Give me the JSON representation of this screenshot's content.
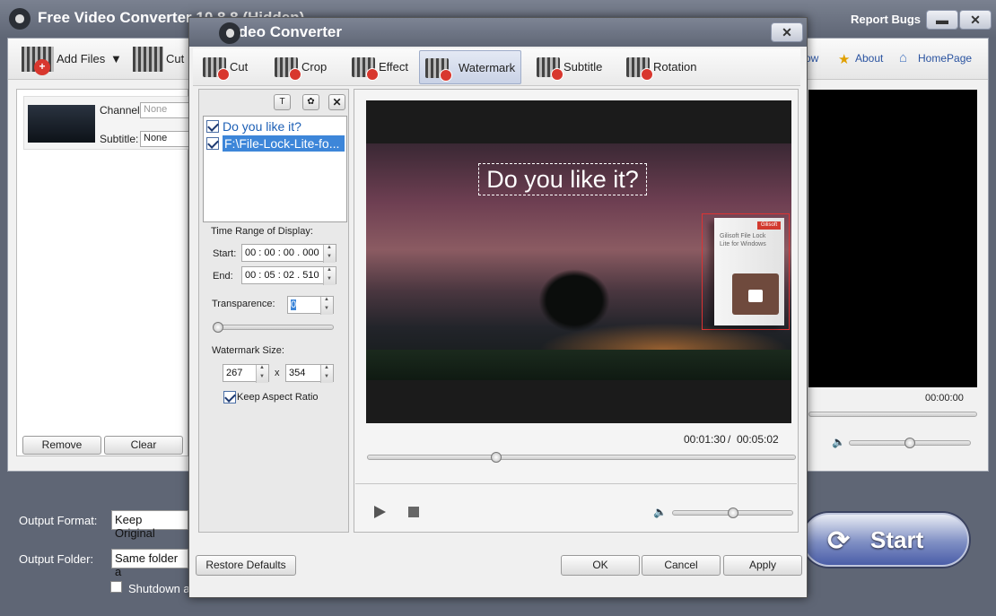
{
  "main": {
    "title": "Free Video Converter 10.8.8 (Hidden)",
    "report_bugs": "Report Bugs",
    "toolbar": {
      "add_files": "Add Files",
      "cut": "Cut",
      "about": "About",
      "homepage": "HomePage",
      "partial": "ow"
    },
    "file": {
      "channel_label": "Channel:",
      "channel_value": "None",
      "subtitle_label": "Subtitle:",
      "subtitle_value": "None"
    },
    "remove": "Remove",
    "clear": "Clear",
    "preview_time": "00:00:00",
    "output_format_label": "Output Format:",
    "output_format_value": "Keep Original",
    "output_folder_label": "Output Folder:",
    "output_folder_value": "Same folder a",
    "shutdown_label": "Shutdown a",
    "start": "Start"
  },
  "dialog": {
    "title": "Video Converter",
    "tabs": [
      {
        "label": "Cut"
      },
      {
        "label": "Crop"
      },
      {
        "label": "Effect"
      },
      {
        "label": "Watermark"
      },
      {
        "label": "Subtitle"
      },
      {
        "label": "Rotation"
      }
    ],
    "active_tab": "Watermark",
    "watermarks": [
      {
        "text": "Do you like it?",
        "checked": true
      },
      {
        "text": "F:\\File-Lock-Lite-fo...",
        "checked": true
      }
    ],
    "time_range_label": "Time Range of Display:",
    "start_label": "Start:",
    "start_value": "00 : 00 : 00 . 000",
    "end_label": "End:",
    "end_value": "00 : 05 : 02 . 510",
    "transparence_label": "Transparence:",
    "transparence_value": "0",
    "size_label": "Watermark Size:",
    "width_value": "267",
    "x_sep": "x",
    "height_value": "354",
    "keep_aspect_label": "Keep Aspect Ratio",
    "preview_watermark_text": "Do you like it?",
    "product_brand": "Gilisoft",
    "product_name": "Gilisoft File Lock Lite for Windows",
    "current_time": "00:01:30",
    "time_sep": "/",
    "total_time": "00:05:02",
    "restore_defaults": "Restore Defaults",
    "ok": "OK",
    "cancel": "Cancel",
    "apply": "Apply"
  }
}
